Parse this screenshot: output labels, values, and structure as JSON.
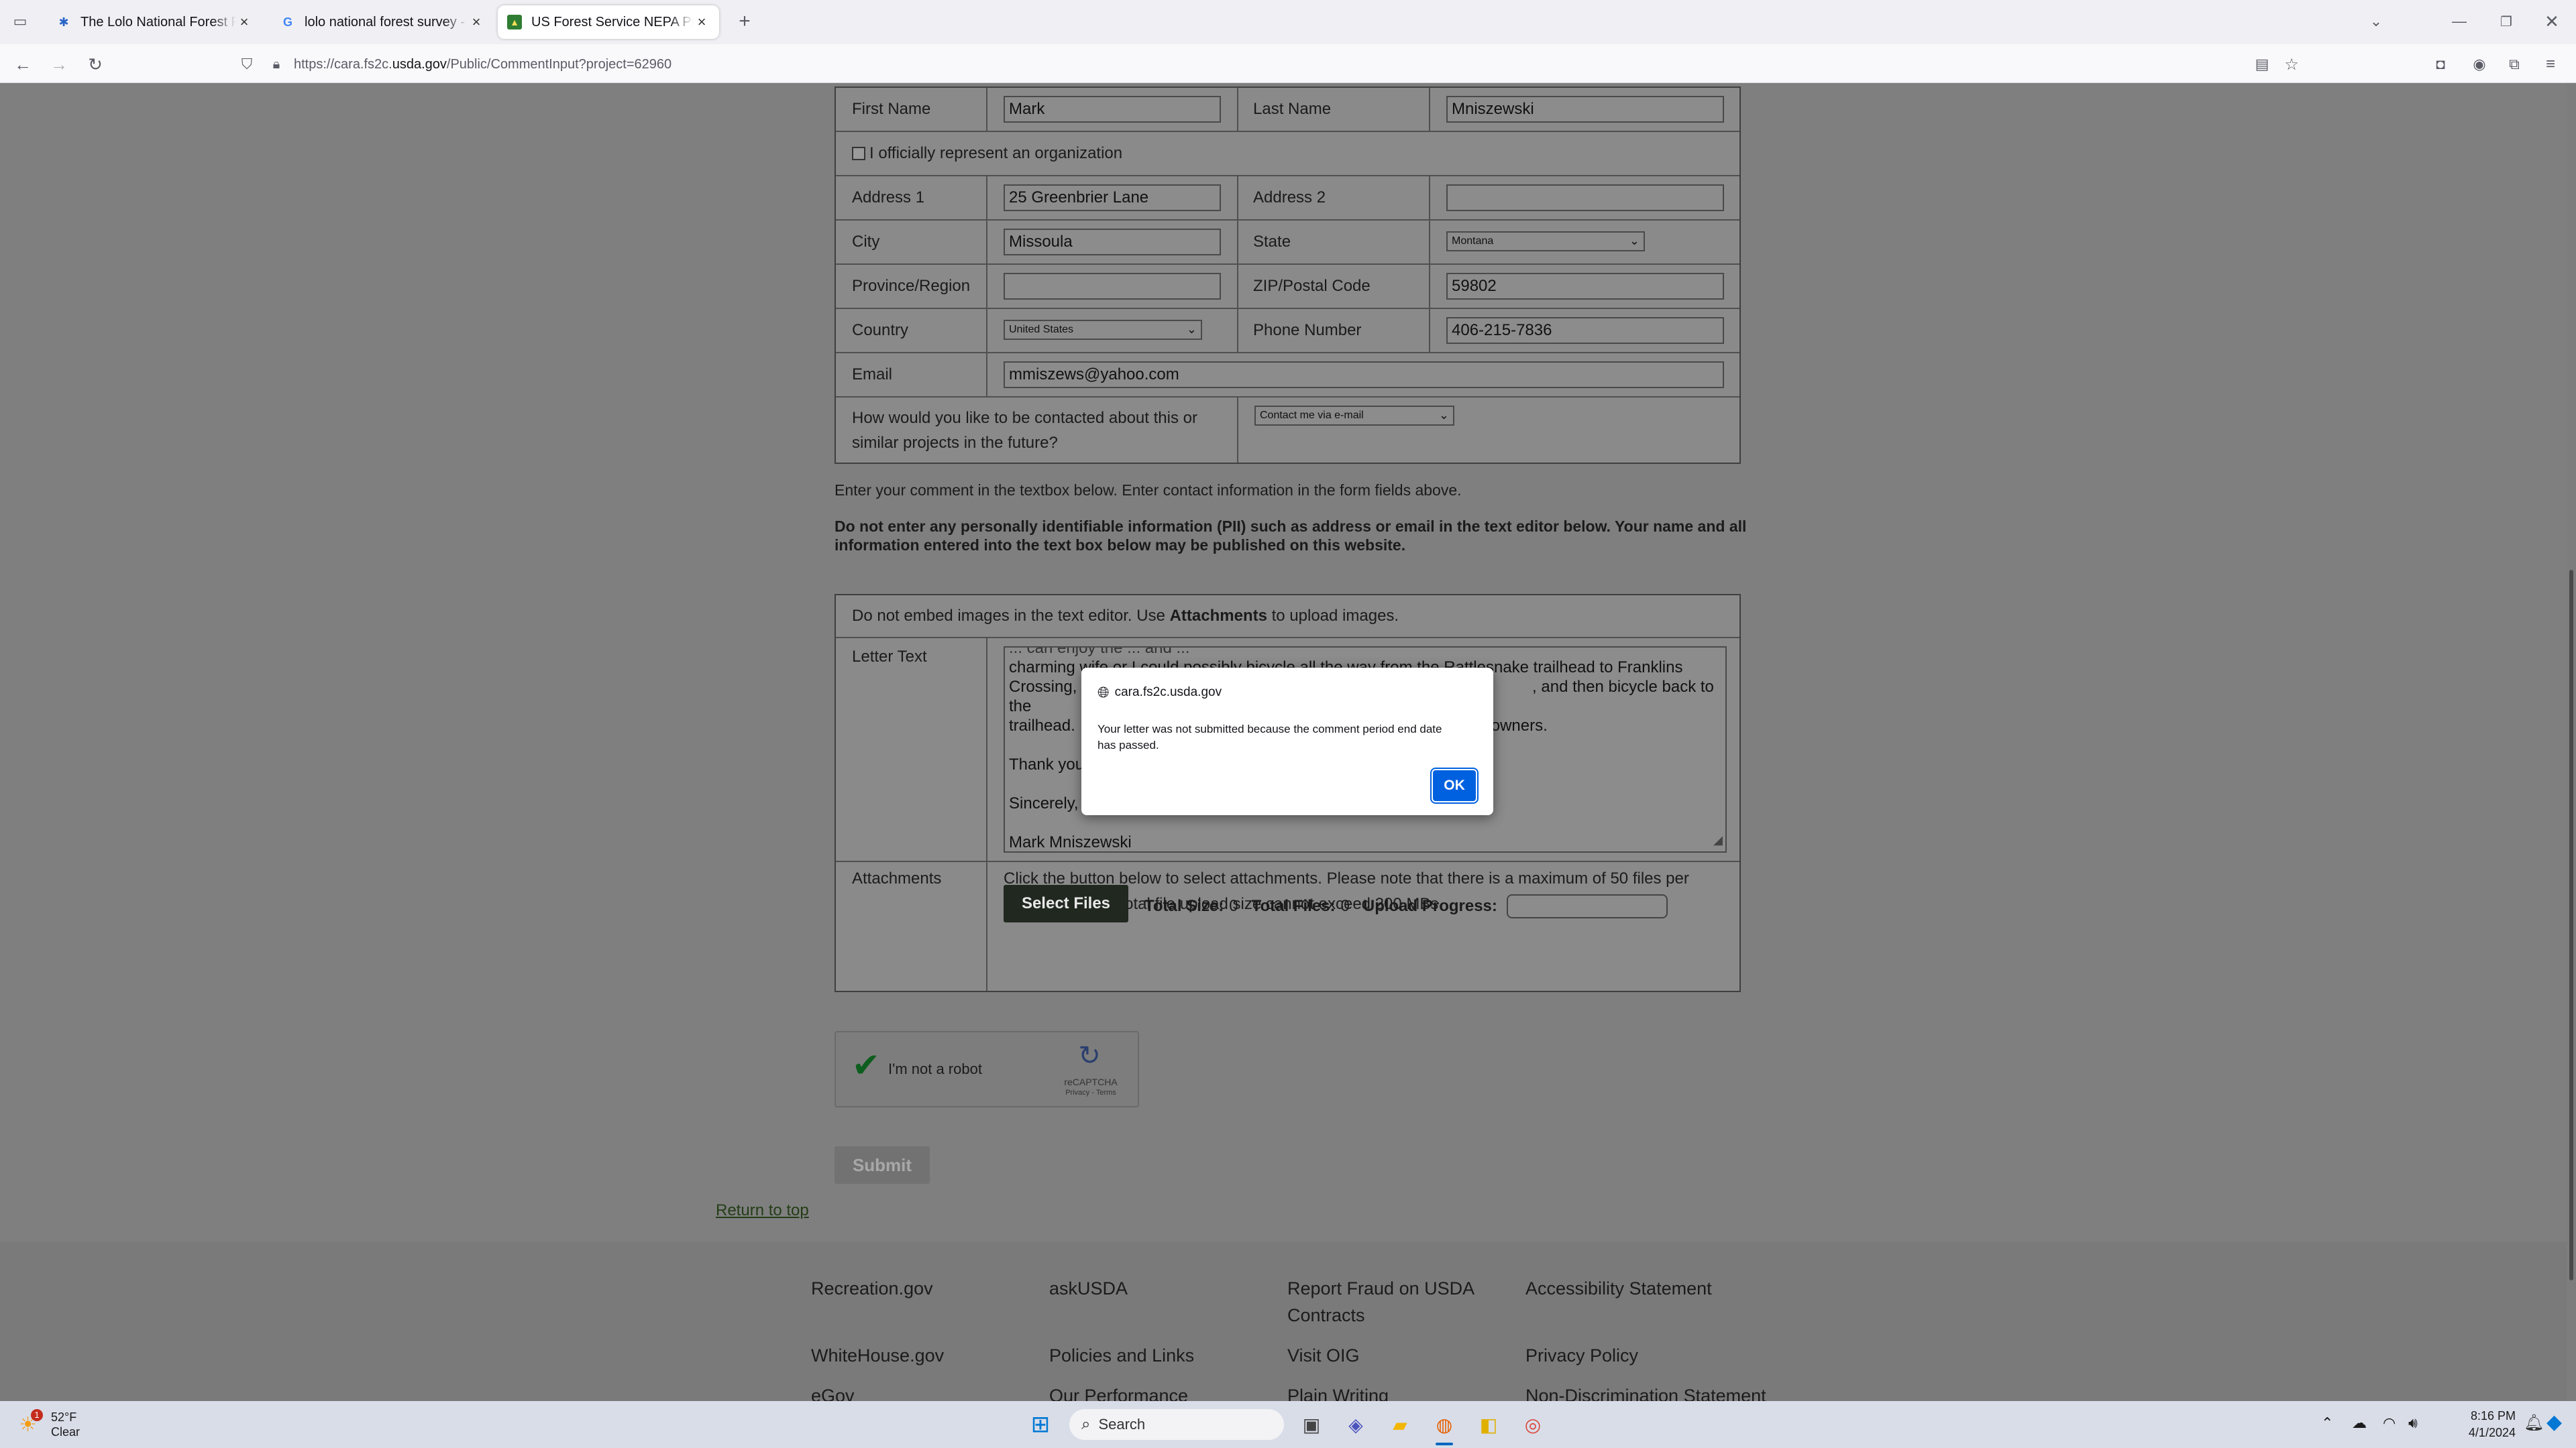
{
  "browser": {
    "tabs": [
      {
        "title": "The Lolo National Forest Planning",
        "active": false
      },
      {
        "title": "lolo national forest survey - Google Search",
        "active": false
      },
      {
        "title": "US Forest Service NEPA Projects",
        "active": true
      }
    ],
    "url_prefix": "https://cara.fs2c.",
    "url_domain": "usda.gov",
    "url_path": "/Public/CommentInput?project=62960"
  },
  "form": {
    "first_name_label": "First Name",
    "first_name_value": "Mark",
    "last_name_label": "Last Name",
    "last_name_value": "Mniszewski",
    "org_checkbox_label": "I officially represent an organization",
    "address1_label": "Address 1",
    "address1_value": "25 Greenbrier Lane",
    "address2_label": "Address 2",
    "address2_value": "",
    "city_label": "City",
    "city_value": "Missoula",
    "state_label": "State",
    "state_value": "Montana",
    "province_label": "Province/Region",
    "province_value": "",
    "zip_label": "ZIP/Postal Code",
    "zip_value": "59802",
    "country_label": "Country",
    "country_value": "United States",
    "phone_label": "Phone Number",
    "phone_value": "406-215-7836",
    "email_label": "Email",
    "email_value": "mmiszews@yahoo.com",
    "contact_question_line1": "How would you like to be contacted about this or",
    "contact_question_line2": "similar projects in the future?",
    "contact_value": "Contact me via e-mail"
  },
  "instructions": {
    "line1": "Enter your comment in the textbox below. Enter contact information in the form fields above.",
    "pii_line1": "Do not enter any personally identifiable information (PII) such as address or email in the text editor below. Your name and all",
    "pii_line2": "information entered into the text box below may be published on this website."
  },
  "comment": {
    "embed_prefix": "Do not embed images in the text editor. Use ",
    "embed_bold": "Attachments",
    "embed_suffix": " to upload images.",
    "letter_label": "Letter Text",
    "letter_line0": "... can enjoy the ... and ...",
    "letter_line1": "charming wife or I could possibly bicycle all the way from the Rattlesnake trailhead to Franklins",
    "letter_line2a": "Crossing, c",
    "letter_line2b": ", and then bicycle back to the",
    "letter_line3a": "trailhead.",
    "letter_line3b": "owners.",
    "letter_thanks": "Thank you",
    "letter_sincerely": "Sincerely,",
    "letter_name": "Mark Mniszewski",
    "attachments_label": "Attachments",
    "attach_note_line1": "Click the button below to select attachments. Please note that there is a maximum of 50 files per",
    "attach_note_line2": "submission and total file upload size cannot exceed 200 MBs",
    "select_files": "Select Files",
    "total_size_label": "Total Size:",
    "total_size_value": "0",
    "total_files_label": "Total Files:",
    "total_files_value": "0",
    "upload_progress_label": "Upload Progress:"
  },
  "captcha": {
    "label": "I'm not a robot",
    "brand": "reCAPTCHA",
    "links": "Privacy - Terms"
  },
  "submit_label": "Submit",
  "return_to_top": "Return to top",
  "footer": {
    "col1": [
      "Recreation.gov",
      "WhiteHouse.gov",
      "eGov"
    ],
    "col2": [
      "askUSDA",
      "Policies and Links",
      "Our Performance"
    ],
    "col3_line1": "Report Fraud on USDA",
    "col3_line2": "Contracts",
    "col3": [
      "Visit OIG",
      "Plain Writing"
    ],
    "col4": [
      "Accessibility Statement",
      "Privacy Policy",
      "Non-Discrimination Statement"
    ]
  },
  "dialog": {
    "origin": "cara.fs2c.usda.gov",
    "message_line1": "Your letter was not submitted because the comment period end date",
    "message_line2": "has passed.",
    "ok_label": "OK"
  },
  "taskbar": {
    "weather_temp": "52°F",
    "weather_desc": "Clear",
    "weather_badge": "1",
    "search_placeholder": "Search",
    "time": "8:16 PM",
    "date": "4/1/2024"
  }
}
